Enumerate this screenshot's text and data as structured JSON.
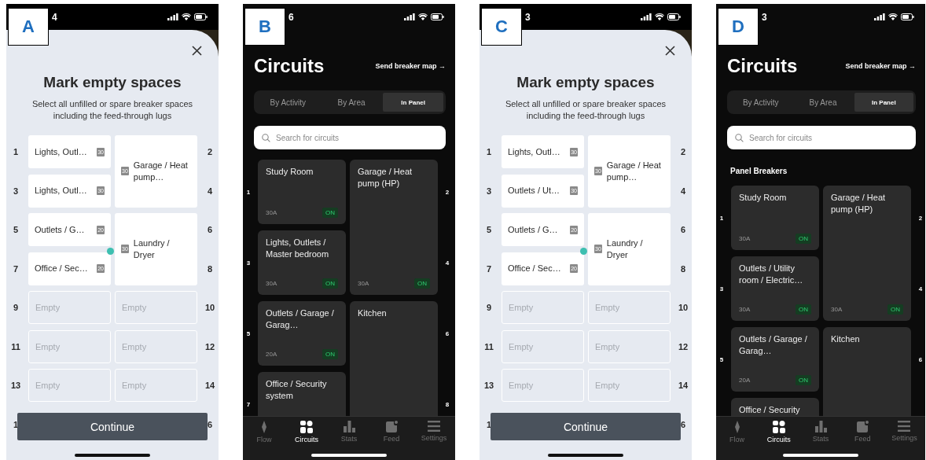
{
  "screens": [
    {
      "kind": "mark_empty",
      "label": "A",
      "status_time": "4",
      "title": "Mark empty spaces",
      "subtitle": "Select all unfilled or spare breaker spaces including the feed-through lugs",
      "left_numbers": [
        "1",
        "3",
        "5",
        "7",
        "9",
        "11",
        "13",
        "1"
      ],
      "right_numbers": [
        "2",
        "4",
        "6",
        "8",
        "10",
        "12",
        "14",
        "6"
      ],
      "left": [
        {
          "kind": "breaker",
          "name": "Lights, Outl…",
          "amps": "30",
          "tall": false
        },
        {
          "kind": "breaker",
          "name": "Lights, Outl…",
          "amps": "30",
          "tall": false
        },
        {
          "kind": "breaker",
          "name": "Outlets / G…",
          "amps": "20",
          "tall": false
        },
        {
          "kind": "breaker",
          "name": "Office / Sec…",
          "amps": "20",
          "tall": false
        },
        {
          "kind": "empty",
          "name": "Empty",
          "tall": false
        },
        {
          "kind": "empty",
          "name": "Empty",
          "tall": false
        },
        {
          "kind": "empty",
          "name": "Empty",
          "tall": false
        }
      ],
      "right": [
        {
          "kind": "breaker",
          "name": "Garage / Heat pump…",
          "amps": "30",
          "tall": true
        },
        {
          "kind": "breaker",
          "name": "Laundry / Dryer",
          "amps": "30",
          "tall": true
        },
        {
          "kind": "empty",
          "name": "Empty",
          "tall": false
        },
        {
          "kind": "empty",
          "name": "Empty",
          "tall": false
        },
        {
          "kind": "empty",
          "name": "Empty",
          "tall": false
        }
      ],
      "button": "Continue"
    },
    {
      "kind": "circuits",
      "label": "B",
      "status_time": "6",
      "title": "Circuits",
      "link": "Send breaker map →",
      "tabs": [
        {
          "label": "By Activity",
          "selected": false
        },
        {
          "label": "By Area",
          "selected": false
        },
        {
          "label": "In Panel",
          "selected": true
        }
      ],
      "search": {
        "placeholder": "Search for circuits"
      },
      "left_numbers": [
        "1",
        "3",
        "5",
        "7"
      ],
      "right_numbers": [
        "2",
        "4",
        "6",
        "8"
      ],
      "left": [
        {
          "name": "Study Room",
          "amps": "30A",
          "status": "ON",
          "tall": false
        },
        {
          "name": "Lights, Outlets / Master bedroom",
          "amps": "30A",
          "status": "ON",
          "tall": false
        },
        {
          "name": "Outlets / Garage / Garag…",
          "amps": "20A",
          "status": "ON",
          "tall": false
        },
        {
          "name": "Office / Security system",
          "tall": false
        }
      ],
      "right": [
        {
          "name": "Garage / Heat pump (HP)",
          "amps": "30A",
          "status": "ON",
          "tall": true
        },
        {
          "name": "Kitchen",
          "tall": true
        }
      ],
      "nav": [
        {
          "label": "Flow",
          "selected": false
        },
        {
          "label": "Circuits",
          "selected": true
        },
        {
          "label": "Stats",
          "selected": false
        },
        {
          "label": "Feed",
          "selected": false
        },
        {
          "label": "Settings",
          "selected": false
        }
      ]
    },
    {
      "kind": "mark_empty",
      "label": "C",
      "status_time": "3",
      "title": "Mark empty spaces",
      "subtitle": "Select all unfilled or spare breaker spaces including the feed-through lugs",
      "left_numbers": [
        "1",
        "3",
        "5",
        "7",
        "9",
        "11",
        "13",
        "1"
      ],
      "right_numbers": [
        "2",
        "4",
        "6",
        "8",
        "10",
        "12",
        "14",
        "6"
      ],
      "left": [
        {
          "kind": "breaker",
          "name": "Lights, Outl…",
          "amps": "30",
          "tall": false
        },
        {
          "kind": "breaker",
          "name": "Outlets / Ut…",
          "amps": "30",
          "tall": false
        },
        {
          "kind": "breaker",
          "name": "Outlets / G…",
          "amps": "20",
          "tall": false
        },
        {
          "kind": "breaker",
          "name": "Office / Sec…",
          "amps": "20",
          "tall": false
        },
        {
          "kind": "empty",
          "name": "Empty",
          "tall": false
        },
        {
          "kind": "empty",
          "name": "Empty",
          "tall": false
        },
        {
          "kind": "empty",
          "name": "Empty",
          "tall": false
        }
      ],
      "right": [
        {
          "kind": "breaker",
          "name": "Garage / Heat pump…",
          "amps": "30",
          "tall": true
        },
        {
          "kind": "breaker",
          "name": "Laundry / Dryer",
          "amps": "30",
          "tall": true
        },
        {
          "kind": "empty",
          "name": "Empty",
          "tall": false
        },
        {
          "kind": "empty",
          "name": "Empty",
          "tall": false
        },
        {
          "kind": "empty",
          "name": "Empty",
          "tall": false
        }
      ],
      "button": "Continue"
    },
    {
      "kind": "circuits",
      "label": "D",
      "status_time": "3",
      "title": "Circuits",
      "link": "Send breaker map →",
      "tabs": [
        {
          "label": "By Activity",
          "selected": false
        },
        {
          "label": "By Area",
          "selected": false
        },
        {
          "label": "In Panel",
          "selected": true
        }
      ],
      "search": {
        "placeholder": "Search for circuits"
      },
      "section": "Panel Breakers",
      "left_numbers": [
        "1",
        "3",
        "5"
      ],
      "right_numbers": [
        "2",
        "4",
        "6"
      ],
      "left": [
        {
          "name": "Study Room",
          "amps": "30A",
          "status": "ON",
          "tall": false
        },
        {
          "name": "Outlets / Utility room / Electric…",
          "amps": "30A",
          "status": "ON",
          "tall": false
        },
        {
          "name": "Outlets / Garage / Garag…",
          "amps": "20A",
          "status": "ON",
          "tall": false
        },
        {
          "name": "Office / Security",
          "tall": false
        }
      ],
      "right": [
        {
          "name": "Garage / Heat pump (HP)",
          "amps": "30A",
          "status": "ON",
          "tall": true
        },
        {
          "name": "Kitchen",
          "tall": true
        }
      ],
      "nav": [
        {
          "label": "Flow",
          "selected": false
        },
        {
          "label": "Circuits",
          "selected": true
        },
        {
          "label": "Stats",
          "selected": false
        },
        {
          "label": "Feed",
          "selected": false
        },
        {
          "label": "Settings",
          "selected": false
        }
      ]
    }
  ]
}
